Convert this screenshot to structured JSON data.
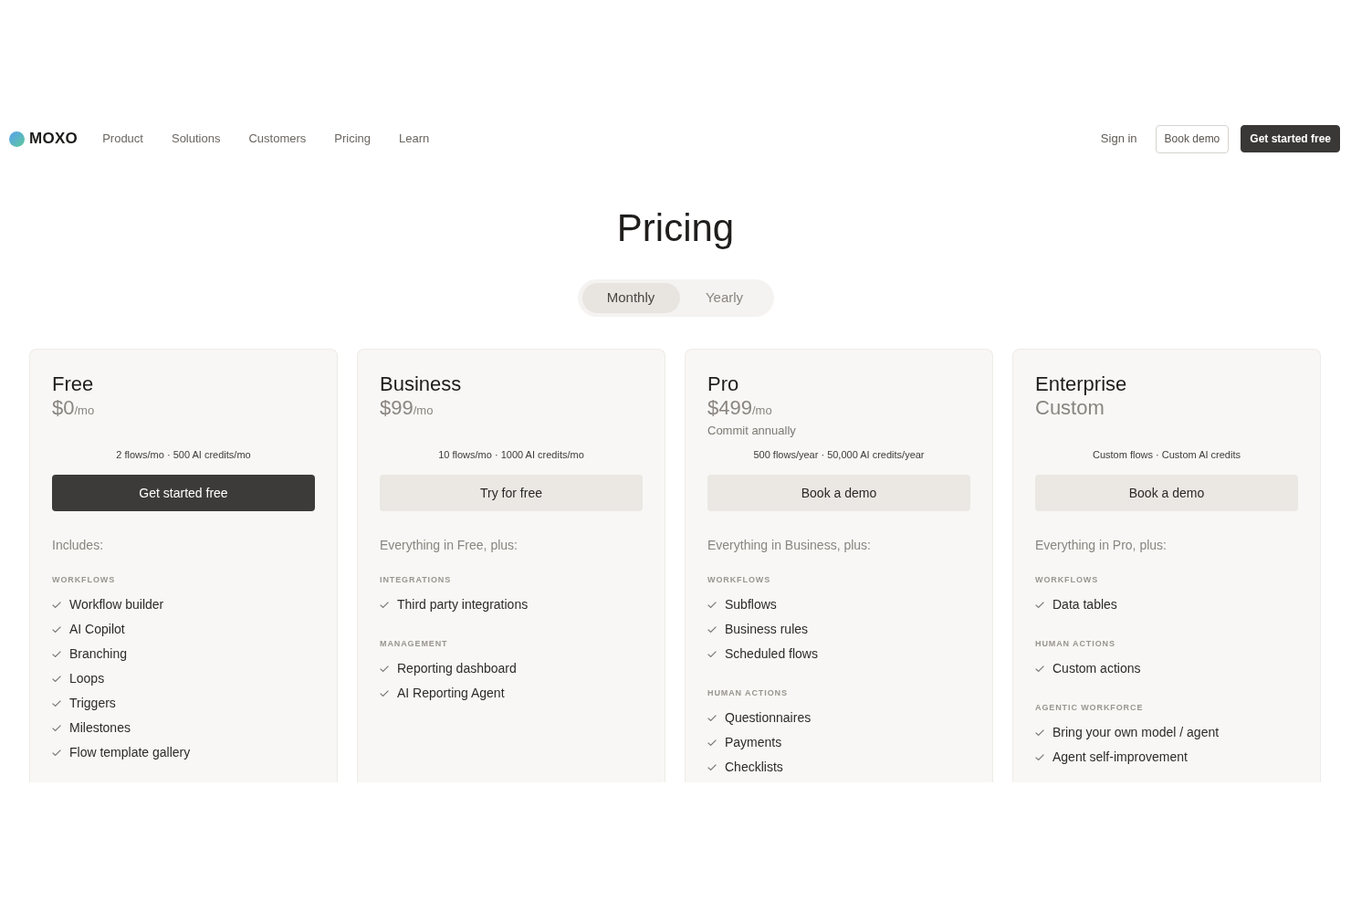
{
  "nav": {
    "logo": "MOXO",
    "links": [
      "Product",
      "Solutions",
      "Customers",
      "Pricing",
      "Learn"
    ],
    "sign_in": "Sign in",
    "buttons": [
      {
        "label": "Book demo",
        "kind": "outline"
      },
      {
        "label": "Get started free",
        "kind": "dark"
      }
    ]
  },
  "title": "Pricing",
  "billing_toggle": [
    {
      "label": "Monthly",
      "selected": true
    },
    {
      "label": "Yearly",
      "selected": false
    }
  ],
  "plans": [
    {
      "name": "Free",
      "price": "$0",
      "period": "/mo",
      "summary": "2 flows/mo · 500 AI credits/mo",
      "button": {
        "label": "Get started free",
        "kind": "primary"
      },
      "intro": "Includes:",
      "sections": [
        {
          "label": "WORKFLOWS",
          "items": [
            "Workflow builder",
            "AI Copilot",
            "Branching",
            "Loops",
            "Triggers",
            "Milestones",
            "Flow template gallery"
          ]
        }
      ]
    },
    {
      "name": "Business",
      "price": "$99",
      "period": "/mo",
      "summary": "10 flows/mo · 1000 AI credits/mo",
      "button": {
        "label": "Try for free",
        "kind": "secondary"
      },
      "intro": "Everything in Free, plus:",
      "sections": [
        {
          "label": "INTEGRATIONS",
          "items": [
            "Third party integrations"
          ]
        },
        {
          "label": "MANAGEMENT",
          "items": [
            "Reporting dashboard",
            "AI Reporting Agent"
          ]
        }
      ]
    },
    {
      "name": "Pro",
      "price": "$499",
      "period": "/mo",
      "note": "Commit annually",
      "summary": "500 flows/year · 50,000 AI credits/year",
      "button": {
        "label": "Book a demo",
        "kind": "secondary"
      },
      "intro": "Everything in Business, plus:",
      "sections": [
        {
          "label": "WORKFLOWS",
          "items": [
            "Subflows",
            "Business rules",
            "Scheduled flows"
          ]
        },
        {
          "label": "HUMAN ACTIONS",
          "items": [
            "Questionnaires",
            "Payments",
            "Checklists"
          ]
        }
      ]
    },
    {
      "name": "Enterprise",
      "price": "Custom",
      "summary": "Custom flows · Custom AI credits",
      "button": {
        "label": "Book a demo",
        "kind": "secondary"
      },
      "intro": "Everything in Pro, plus:",
      "sections": [
        {
          "label": "WORKFLOWS",
          "items": [
            "Data tables"
          ]
        },
        {
          "label": "HUMAN ACTIONS",
          "items": [
            "Custom actions"
          ]
        },
        {
          "label": "AGENTIC WORKFORCE",
          "items": [
            "Bring your own model / agent",
            "Agent self-improvement"
          ]
        }
      ]
    }
  ]
}
